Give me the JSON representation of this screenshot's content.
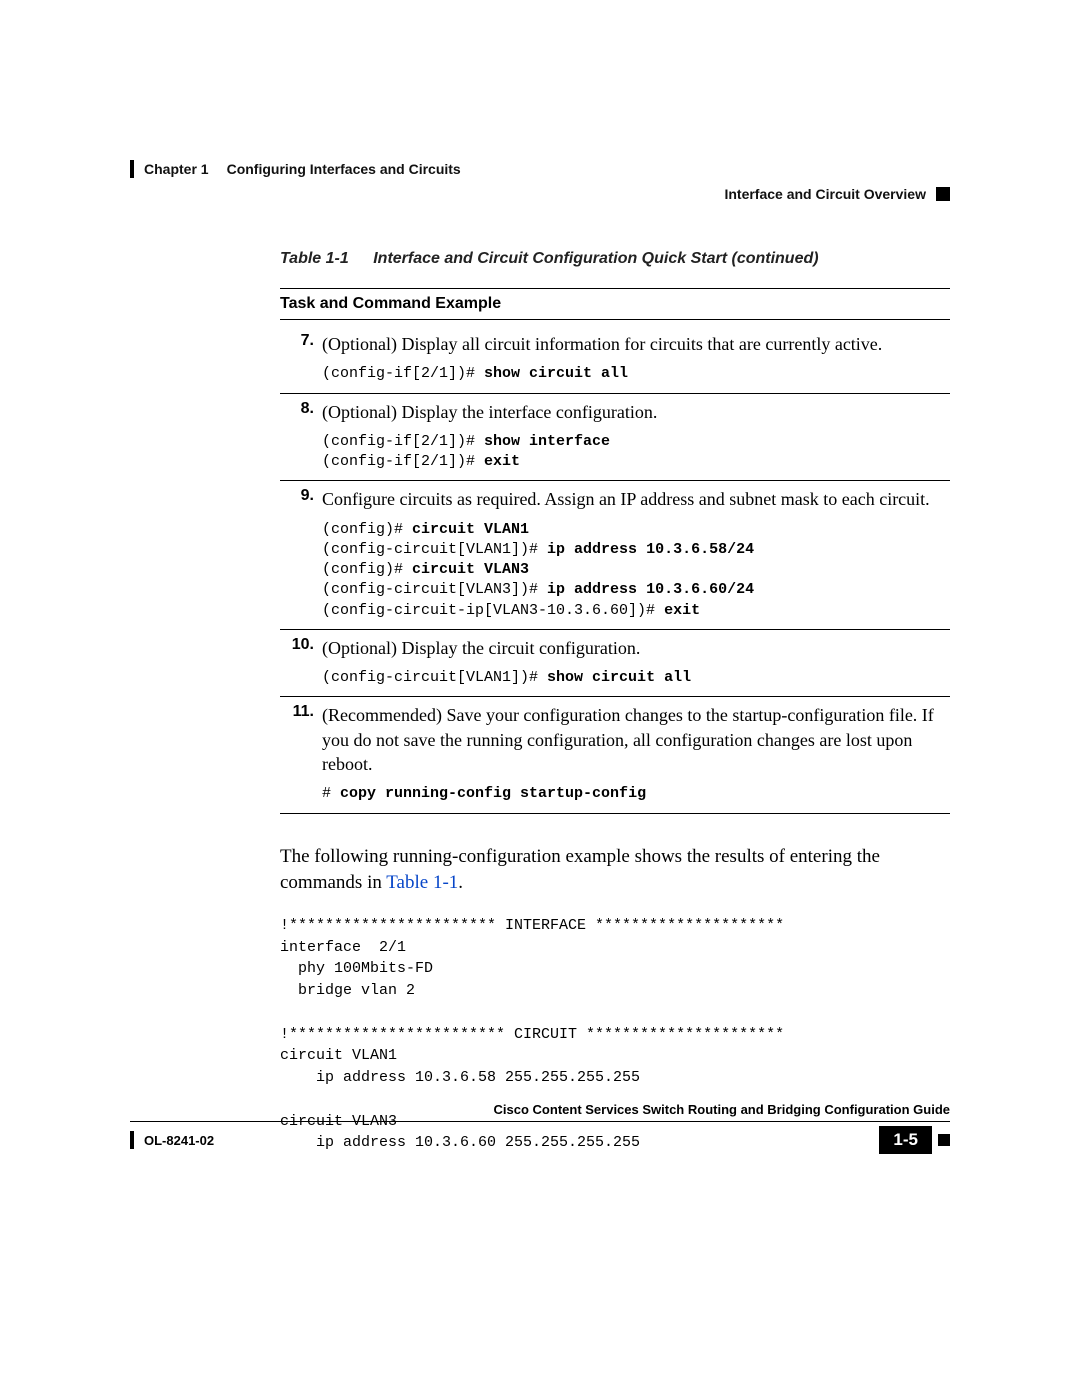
{
  "header": {
    "chapter": "Chapter 1",
    "chapter_title": "Configuring Interfaces and Circuits",
    "section": "Interface and Circuit Overview"
  },
  "table": {
    "label": "Table 1-1",
    "title": "Interface and Circuit Configuration Quick Start (continued)",
    "column_header": "Task and Command Example",
    "rows": [
      {
        "num": "7.",
        "text": "(Optional) Display all circuit information for circuits that are currently active.",
        "cmd_lines": [
          {
            "prompt": "(config-if[2/1])# ",
            "bold": "show circuit all"
          }
        ]
      },
      {
        "num": "8.",
        "text": "(Optional) Display the interface configuration.",
        "cmd_lines": [
          {
            "prompt": "(config-if[2/1])# ",
            "bold": "show interface"
          },
          {
            "prompt": "(config-if[2/1])# ",
            "bold": "exit"
          }
        ]
      },
      {
        "num": "9.",
        "text": "Configure circuits as required. Assign an IP address and subnet mask to each circuit.",
        "cmd_lines": [
          {
            "prompt": "(config)# ",
            "bold": "circuit VLAN1"
          },
          {
            "prompt": "(config-circuit[VLAN1])# ",
            "bold": "ip address 10.3.6.58/24"
          },
          {
            "prompt": "(config)# ",
            "bold": "circuit VLAN3"
          },
          {
            "prompt": "(config-circuit[VLAN3])# ",
            "bold": "ip address 10.3.6.60/24"
          },
          {
            "prompt": "(config-circuit-ip[VLAN3-10.3.6.60])# ",
            "bold": "exit"
          }
        ]
      },
      {
        "num": "10.",
        "text": "(Optional) Display the circuit configuration.",
        "cmd_lines": [
          {
            "prompt": "(config-circuit[VLAN1])# ",
            "bold": "show circuit all"
          }
        ]
      },
      {
        "num": "11.",
        "text": "(Recommended) Save your configuration changes to the startup-configuration file. If you do not save the running configuration, all configuration changes are lost upon reboot.",
        "cmd_lines": [
          {
            "prompt": "# ",
            "bold": "copy running-config startup-config"
          }
        ]
      }
    ]
  },
  "after_text_1": "The following running-configuration example shows the results of entering the commands in ",
  "after_link": "Table 1-1",
  "after_text_2": ".",
  "code_block": "!*********************** INTERFACE *********************\ninterface  2/1\n  phy 100Mbits-FD\n  bridge vlan 2\n\n!************************ CIRCUIT **********************\ncircuit VLAN1\n    ip address 10.3.6.58 255.255.255.255\n\ncircuit VLAN3\n    ip address 10.3.6.60 255.255.255.255",
  "footer": {
    "guide": "Cisco Content Services Switch Routing and Bridging Configuration Guide",
    "doc": "OL-8241-02",
    "page": "1-5"
  }
}
